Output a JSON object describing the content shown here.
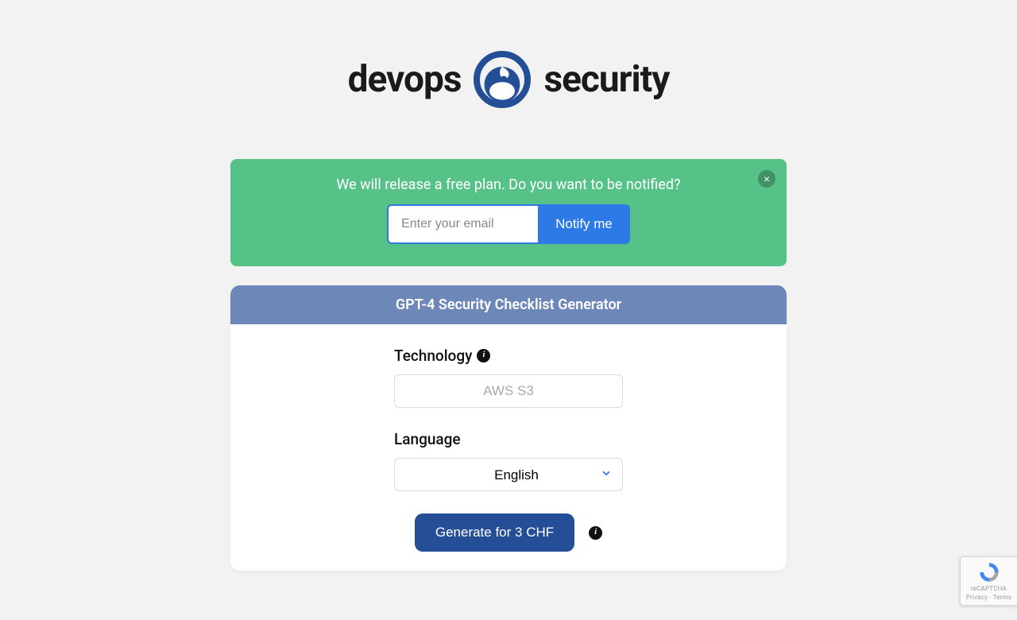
{
  "brand": {
    "left": "devops",
    "right": "security"
  },
  "alert": {
    "text": "We will release a free plan. Do you want to be notified?",
    "email_placeholder": "Enter your email",
    "notify_label": "Notify me",
    "close_glyph": "×"
  },
  "card": {
    "title": "GPT-4 Security Checklist Generator",
    "technology_label": "Technology",
    "technology_placeholder": "AWS S3",
    "language_label": "Language",
    "language_value": "English",
    "generate_label": "Generate for 3 CHF",
    "info_glyph": "i"
  },
  "recaptcha": {
    "product": "reCAPTCHA",
    "privacy": "Privacy",
    "terms": "Terms",
    "sep": " - "
  },
  "colors": {
    "alert_bg": "#56c288",
    "primary_blue": "#2d79e6",
    "card_header": "#6d87b9",
    "generate_bg": "#244f97"
  }
}
